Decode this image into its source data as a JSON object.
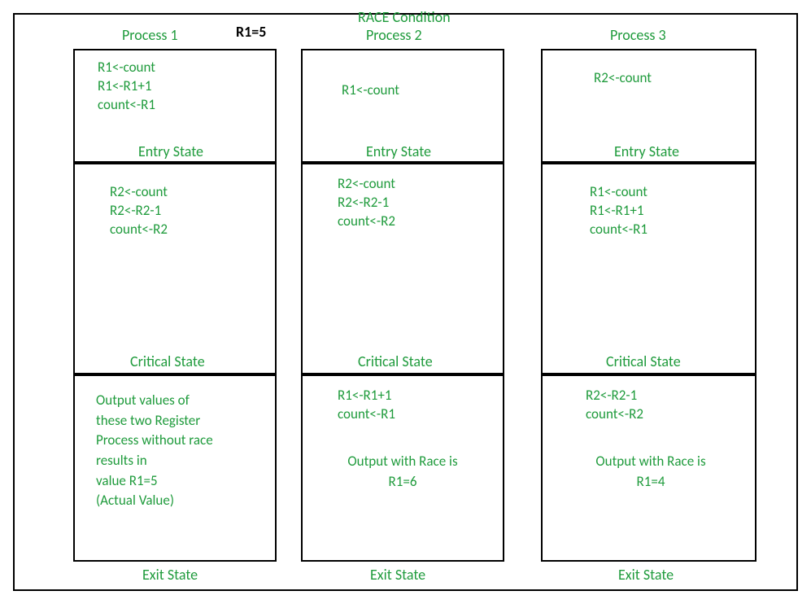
{
  "title": "RACE Condition",
  "register_note": "R1=5",
  "columns": [
    {
      "header": "Process 1",
      "entry_lines": "R1<-count\nR1<-R1+1\ncount<-R1",
      "entry_label": "Entry State",
      "critical_lines": "R2<-count\nR2<-R2-1\ncount<-R2",
      "critical_label": "Critical State",
      "exit_lines": "",
      "exit_output": "Output values of\nthese two Register\nProcess without race\nresults in\nvalue R1=5\n(Actual Value)",
      "exit_label": "Exit State"
    },
    {
      "header": "Process 2",
      "entry_lines": "R1<-count",
      "entry_label": "Entry State",
      "critical_lines": "R2<-count\nR2<-R2-1\ncount<-R2",
      "critical_label": "Critical State",
      "exit_lines": "R1<-R1+1\ncount<-R1",
      "exit_output": "Output with Race is\nR1=6",
      "exit_label": "Exit State"
    },
    {
      "header": "Process 3",
      "entry_lines": "R2<-count",
      "entry_label": "Entry State",
      "critical_lines": "R1<-count\nR1<-R1+1\ncount<-R1",
      "critical_label": "Critical State",
      "exit_lines": "R2<-R2-1\ncount<-R2",
      "exit_output": "Output with Race is\nR1=4",
      "exit_label": "Exit State"
    }
  ]
}
